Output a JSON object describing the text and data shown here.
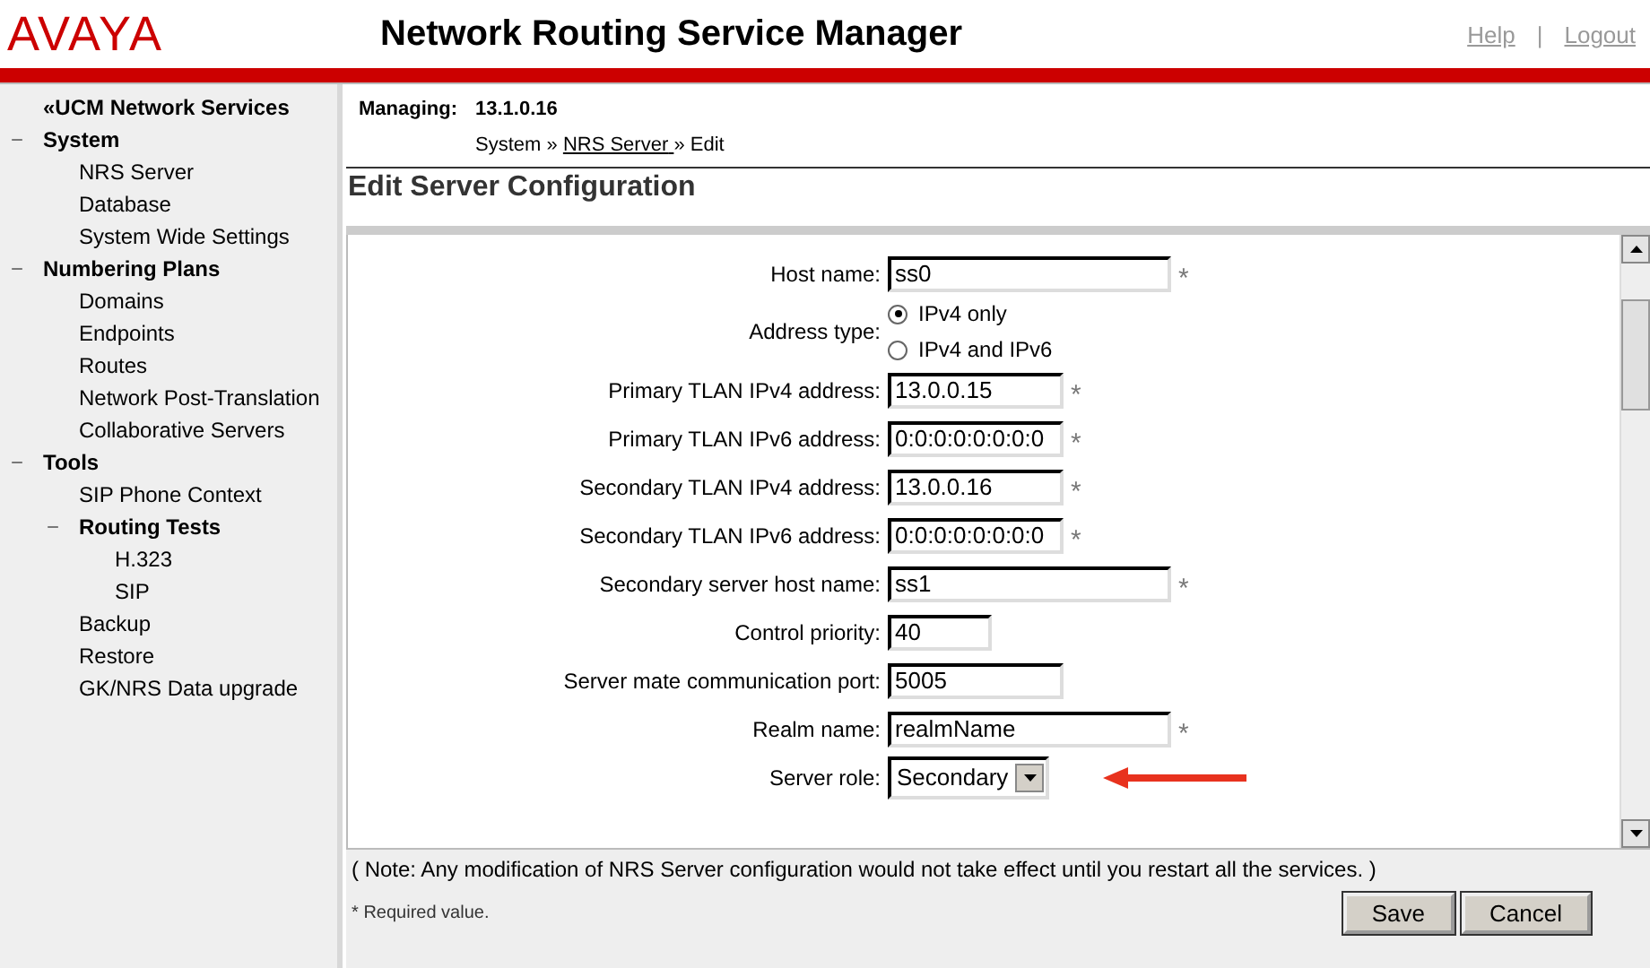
{
  "header": {
    "logo": "AVAYA",
    "title": "Network Routing Service Manager",
    "links": [
      "Help",
      "Logout"
    ],
    "separator": "|"
  },
  "sidebar": {
    "back_link": "«UCM Network Services",
    "items": [
      {
        "label": "System",
        "expanded": true,
        "toggle": "−",
        "children": [
          {
            "label": "NRS Server"
          },
          {
            "label": "Database"
          },
          {
            "label": "System Wide Settings"
          }
        ]
      },
      {
        "label": "Numbering Plans",
        "expanded": true,
        "toggle": "−",
        "children": [
          {
            "label": "Domains"
          },
          {
            "label": "Endpoints"
          },
          {
            "label": "Routes"
          },
          {
            "label": "Network Post-Translation"
          },
          {
            "label": "Collaborative Servers"
          }
        ]
      },
      {
        "label": "Tools",
        "expanded": true,
        "toggle": "−",
        "children": [
          {
            "label": "SIP Phone Context"
          },
          {
            "label": "Routing Tests",
            "expanded": true,
            "toggle": "−",
            "children": [
              {
                "label": "H.323"
              },
              {
                "label": "SIP"
              }
            ]
          },
          {
            "label": "Backup"
          },
          {
            "label": "Restore"
          },
          {
            "label": "GK/NRS Data upgrade"
          }
        ]
      }
    ]
  },
  "managing": {
    "label": "Managing:",
    "value": "13.1.0.16"
  },
  "breadcrumb": {
    "parts": [
      "System",
      "NRS Server",
      "Edit"
    ],
    "separator": "»"
  },
  "heading": "Edit Server Configuration",
  "form": {
    "rows": [
      {
        "kind": "longtext",
        "label": "Host name:",
        "value": "ss0",
        "required": true
      },
      {
        "kind": "radio",
        "label": "Address type:",
        "options": [
          {
            "label": "IPv4 only",
            "selected": true
          },
          {
            "label": "IPv4 and IPv6",
            "selected": false
          }
        ]
      },
      {
        "kind": "text",
        "label": "Primary TLAN IPv4 address:",
        "value": "13.0.0.15",
        "required": true
      },
      {
        "kind": "text",
        "label": "Primary TLAN IPv6 address:",
        "value": "0:0:0:0:0:0:0:0",
        "required": true
      },
      {
        "kind": "text",
        "label": "Secondary TLAN IPv4 address:",
        "value": "13.0.0.16",
        "required": true
      },
      {
        "kind": "text",
        "label": "Secondary TLAN IPv6 address:",
        "value": "0:0:0:0:0:0:0:0",
        "required": true
      },
      {
        "kind": "longtext",
        "label": "Secondary server host name:",
        "value": "ss1",
        "required": true
      },
      {
        "kind": "shorttext",
        "label": "Control priority:",
        "value": "40",
        "required": false
      },
      {
        "kind": "text",
        "label": "Server mate communication port:",
        "value": "5005",
        "required": false
      },
      {
        "kind": "longtext",
        "label": "Realm name:",
        "value": "realmName",
        "required": true
      },
      {
        "kind": "select",
        "label": "Server role:",
        "value": "Secondary",
        "pointer_arrow": true
      }
    ]
  },
  "note": "( Note: Any modification of NRS Server configuration would not take effect until you restart all the services. )",
  "required_legend": {
    "mark": "*",
    "text": "Required value."
  },
  "buttons": [
    "Save",
    "Cancel"
  ]
}
